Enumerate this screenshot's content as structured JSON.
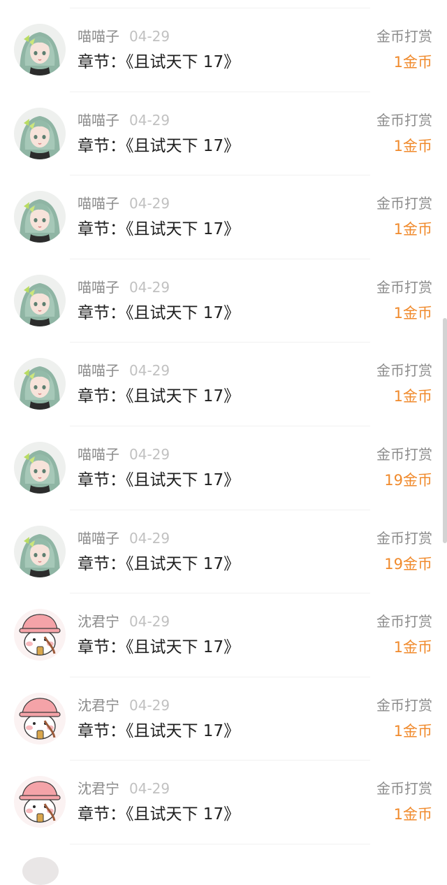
{
  "colors": {
    "amount": "#f08a2c",
    "username": "#8c8c8c",
    "date": "#c1c1c1",
    "chapter": "#1e1e1e"
  },
  "rewards": [
    {
      "username": "喵喵子",
      "date": "04-29",
      "chapter": "章节：《且试天下 17》",
      "type": "金币打赏",
      "amount": "1金币",
      "avatar": "green-haired-girl-avatar"
    },
    {
      "username": "喵喵子",
      "date": "04-29",
      "chapter": "章节：《且试天下 17》",
      "type": "金币打赏",
      "amount": "1金币",
      "avatar": "green-haired-girl-avatar"
    },
    {
      "username": "喵喵子",
      "date": "04-29",
      "chapter": "章节：《且试天下 17》",
      "type": "金币打赏",
      "amount": "1金币",
      "avatar": "green-haired-girl-avatar"
    },
    {
      "username": "喵喵子",
      "date": "04-29",
      "chapter": "章节：《且试天下 17》",
      "type": "金币打赏",
      "amount": "1金币",
      "avatar": "green-haired-girl-avatar"
    },
    {
      "username": "喵喵子",
      "date": "04-29",
      "chapter": "章节：《且试天下 17》",
      "type": "金币打赏",
      "amount": "1金币",
      "avatar": "green-haired-girl-avatar"
    },
    {
      "username": "喵喵子",
      "date": "04-29",
      "chapter": "章节：《且试天下 17》",
      "type": "金币打赏",
      "amount": "19金币",
      "avatar": "green-haired-girl-avatar"
    },
    {
      "username": "喵喵子",
      "date": "04-29",
      "chapter": "章节：《且试天下 17》",
      "type": "金币打赏",
      "amount": "19金币",
      "avatar": "green-haired-girl-avatar"
    },
    {
      "username": "沈君宁",
      "date": "04-29",
      "chapter": "章节：《且试天下 17》",
      "type": "金币打赏",
      "amount": "1金币",
      "avatar": "pink-hat-bear-avatar"
    },
    {
      "username": "沈君宁",
      "date": "04-29",
      "chapter": "章节：《且试天下 17》",
      "type": "金币打赏",
      "amount": "1金币",
      "avatar": "pink-hat-bear-avatar"
    },
    {
      "username": "沈君宁",
      "date": "04-29",
      "chapter": "章节：《且试天下 17》",
      "type": "金币打赏",
      "amount": "1金币",
      "avatar": "pink-hat-bear-avatar"
    }
  ]
}
